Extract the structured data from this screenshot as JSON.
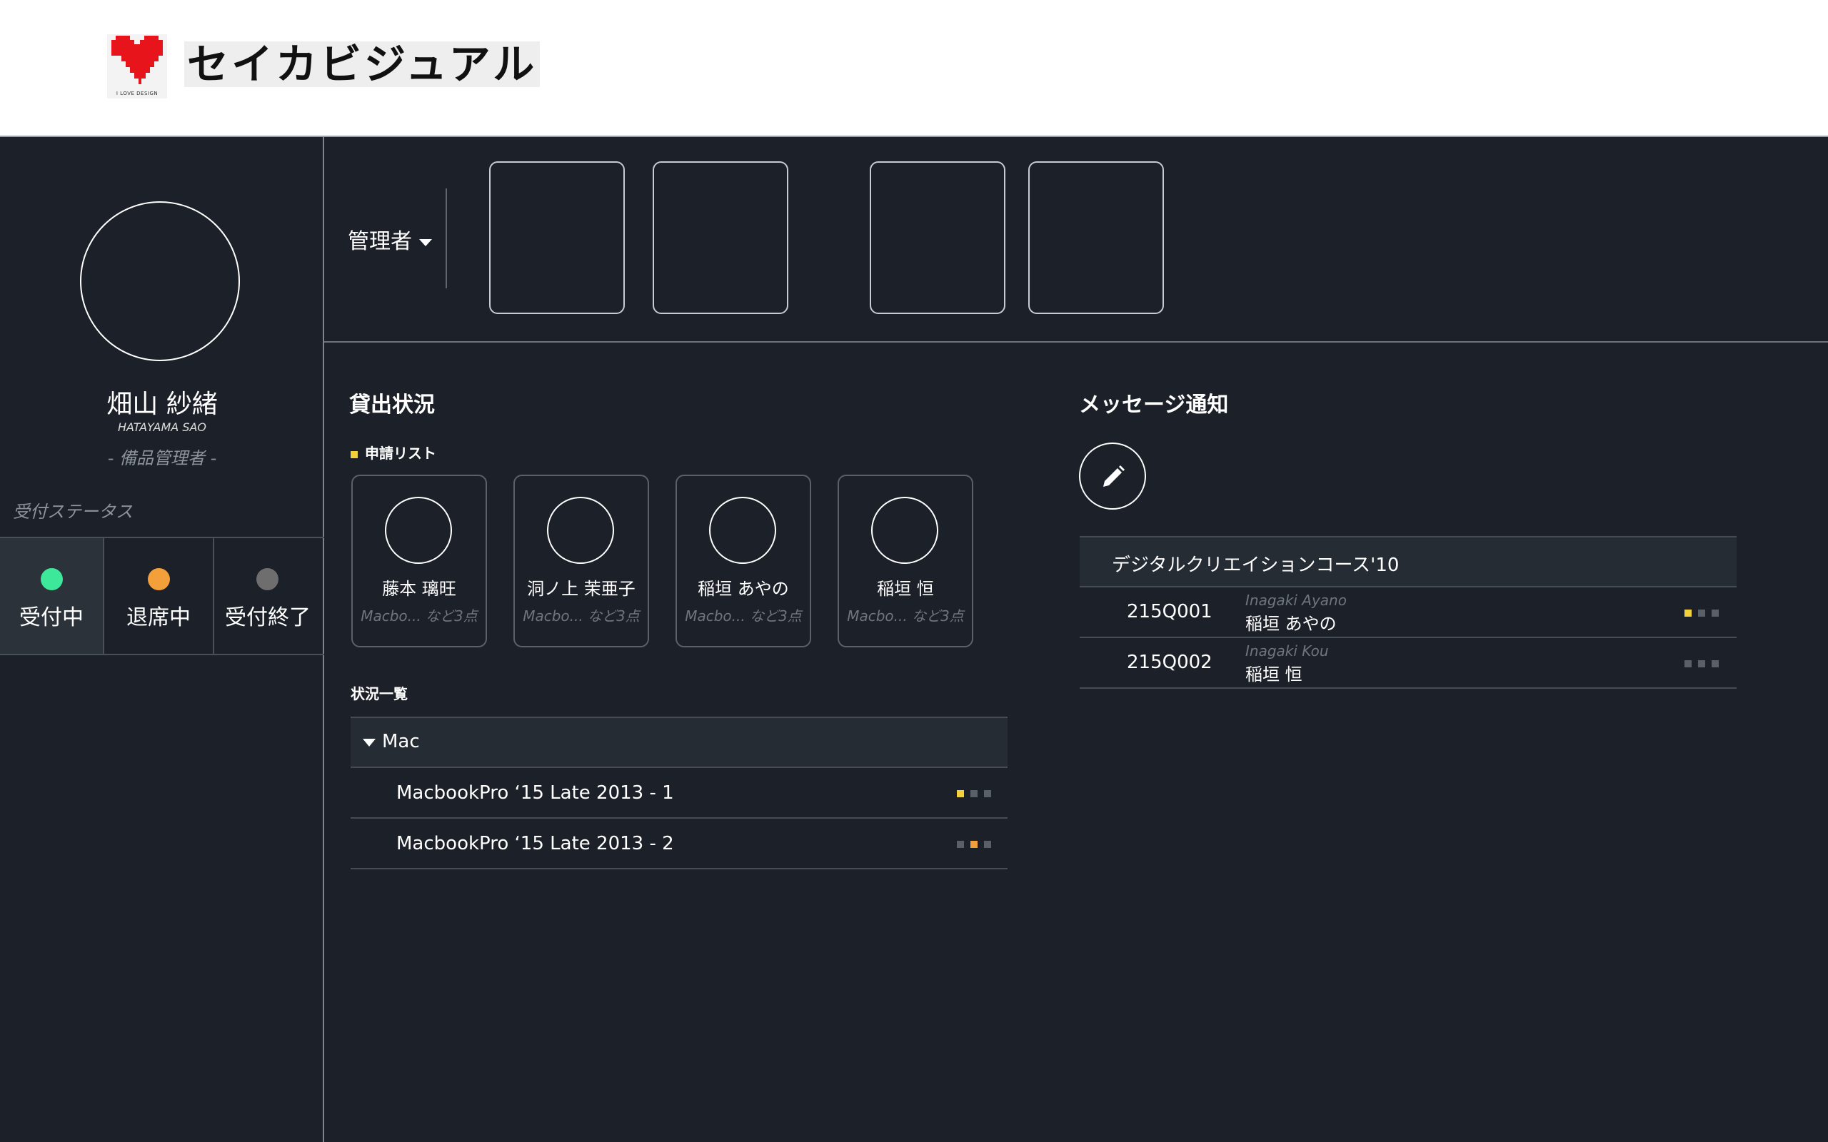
{
  "header": {
    "logo_tagline": "I LOVE DESIGN",
    "logo_text": "セイカビジュアル"
  },
  "user": {
    "name": "畑山 紗緒",
    "name_roman": "HATAYAMA SAO",
    "role": "- 備品管理者 -"
  },
  "status": {
    "title": "受付ステータス",
    "options": [
      {
        "label": "受付中",
        "color": "#3ee89a",
        "active": true
      },
      {
        "label": "退席中",
        "color": "#f4a03a",
        "active": false
      },
      {
        "label": "受付終了",
        "color": "#6e6e6e",
        "active": false
      }
    ]
  },
  "role_select": {
    "label": "管理者"
  },
  "loan": {
    "title": "貸出状況",
    "request_list_label": "申請リスト",
    "requests": [
      {
        "name": "藤本 璃旺",
        "items": "Macbo... など3点"
      },
      {
        "name": "洞ノ上 茉亜子",
        "items": "Macbo... など3点"
      },
      {
        "name": "稲垣 あやの",
        "items": "Macbo... など3点"
      },
      {
        "name": "稲垣 恒",
        "items": "Macbo... など3点"
      }
    ],
    "overview_label": "状況一覧",
    "group": "Mac",
    "items": [
      {
        "label": "MacbookPro ‘15 Late 2013 - 1",
        "indicator_active": 0
      },
      {
        "label": "MacbookPro ‘15 Late 2013 - 2",
        "indicator_active": 1
      }
    ]
  },
  "messages": {
    "title": "メッセージ通知",
    "course": "デジタルクリエイションコース'10",
    "rows": [
      {
        "id": "215Q001",
        "name_roman": "Inagaki Ayano",
        "name": "稲垣 あやの",
        "indicator_active": 0
      },
      {
        "id": "215Q002",
        "name_roman": "Inagaki Kou",
        "name": "稲垣 恒",
        "indicator_active": -1
      }
    ]
  },
  "colors": {
    "background": "#1c2129",
    "indicator_yellow": "#f3d13a",
    "indicator_orange": "#f4a03a",
    "indicator_off": "#5a6068"
  }
}
